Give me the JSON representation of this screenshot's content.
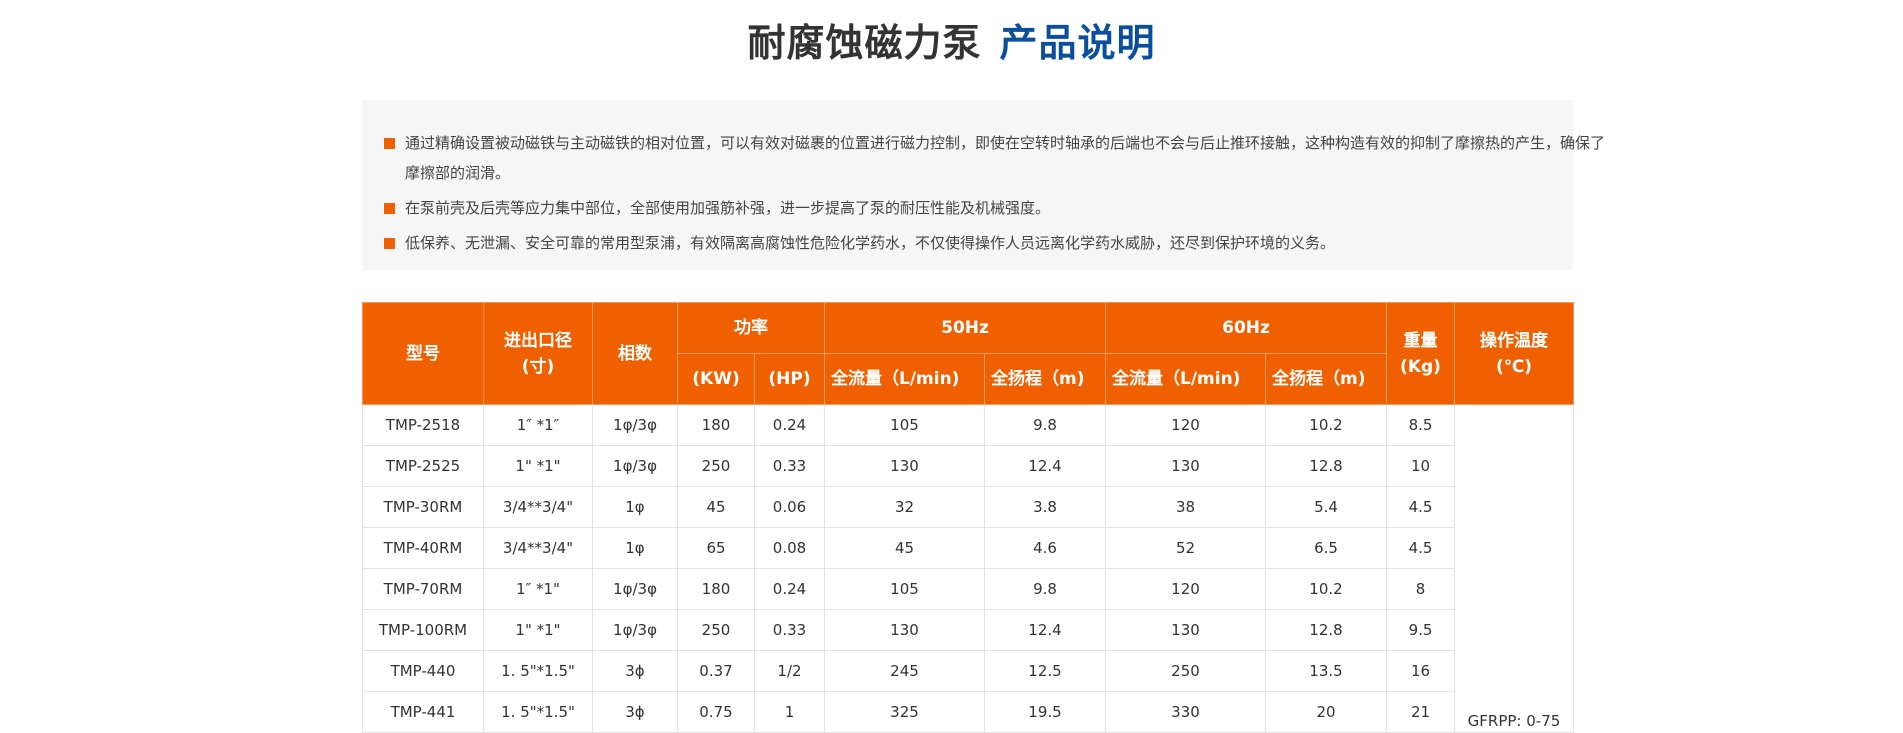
{
  "heading": {
    "main": "耐腐蚀磁力泵",
    "accent": "产品说明"
  },
  "description": [
    "通过精确设置被动磁铁与主动磁铁的相对位置，可以有效对磁裹的位置进行磁力控制，即使在空转时轴承的后端也不会与后止推环接触，这种构造有效的抑制了摩擦热的产生，确保了摩擦部的润滑。",
    "在泵前壳及后壳等应力集中部位，全部使用加强筋补强，进一步提高了泵的耐压性能及机械强度。",
    "低保养、无泄漏、安全可靠的常用型泵浦，有效隔离高腐蚀性危险化学药水，不仅使得操作人员远离化学药水威胁，还尽到保护环境的义务。"
  ],
  "table": {
    "headers": {
      "model": "型号",
      "port_l1": "进出口径",
      "port_l2": "(寸)",
      "phase": "相数",
      "power": "功率",
      "hz50": "50Hz",
      "hz60": "60Hz",
      "weight_l1": "重量",
      "weight_l2": "(Kg)",
      "temp_l1": "操作温度",
      "temp_l2": "(℃)",
      "kw": "(KW)",
      "hp": "(HP)",
      "flow50": "全流量（L/min)",
      "head50": "全扬程（m)",
      "flow60": "全流量（L/min)",
      "head60": "全扬程（m)"
    },
    "rows": [
      [
        "TMP-2518",
        "1″ *1″",
        "1φ/3φ",
        "180",
        "0.24",
        "105",
        "9.8",
        "120",
        "10.2",
        "8.5"
      ],
      [
        "TMP-2525",
        "1\" *1\"",
        "1φ/3φ",
        "250",
        "0.33",
        "130",
        "12.4",
        "130",
        "12.8",
        "10"
      ],
      [
        "TMP-30RM",
        "3/4**3/4\"",
        "1φ",
        "45",
        "0.06",
        "32",
        "3.8",
        "38",
        "5.4",
        "4.5"
      ],
      [
        "TMP-40RM",
        "3/4**3/4\"",
        "1φ",
        "65",
        "0.08",
        "45",
        "4.6",
        "52",
        "6.5",
        "4.5"
      ],
      [
        "TMP-70RM",
        "1″ *1\"",
        "1φ/3φ",
        "180",
        "0.24",
        "105",
        "9.8",
        "120",
        "10.2",
        "8"
      ],
      [
        "TMP-100RM",
        "1\" *1\"",
        "1φ/3φ",
        "250",
        "0.33",
        "130",
        "12.4",
        "130",
        "12.8",
        "9.5"
      ],
      [
        "TMP-440",
        "1. 5\"*1.5\"",
        "3ϕ",
        "0.37",
        "1/2",
        "245",
        "12.5",
        "250",
        "13.5",
        "16"
      ],
      [
        "TMP-441",
        "1. 5\"*1.5\"",
        "3ϕ",
        "0.75",
        "1",
        "325",
        "19.5",
        "330",
        "20",
        "21"
      ]
    ],
    "temp_value": "GFRPP: 0-75"
  }
}
